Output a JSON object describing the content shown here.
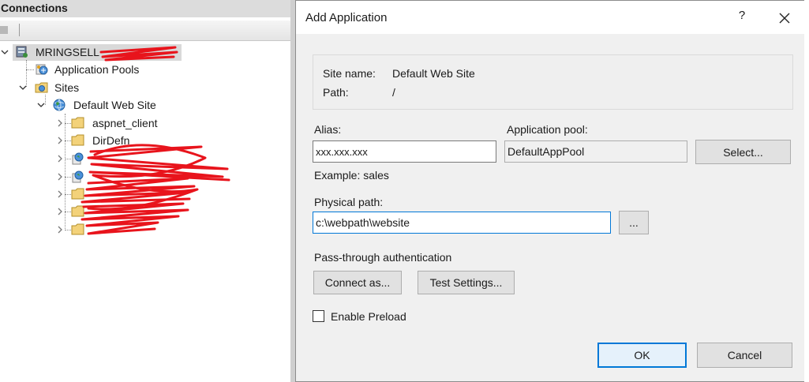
{
  "connections": {
    "title": "Connections",
    "tree": [
      {
        "label": "MRINGSELL"
      },
      {
        "label": "Application Pools"
      },
      {
        "label": "Sites"
      },
      {
        "label": "Default Web Site"
      },
      {
        "label": "aspnet_client"
      },
      {
        "label": "DirDefn"
      },
      {
        "label": ""
      },
      {
        "label": ""
      },
      {
        "label": ""
      },
      {
        "label": ""
      },
      {
        "label": ""
      }
    ]
  },
  "dialog": {
    "title": "Add Application",
    "help": "?",
    "site_name_label": "Site name:",
    "site_name_value": "Default Web Site",
    "path_label": "Path:",
    "path_value": "/",
    "alias_label": "Alias:",
    "alias_value": "xxx.xxx.xxx",
    "alias_example": "Example: sales",
    "app_pool_label": "Application pool:",
    "app_pool_value": "DefaultAppPool",
    "select_button": "Select...",
    "physical_path_label": "Physical path:",
    "physical_path_value": "c:\\webpath\\website",
    "browse_button": "...",
    "passthrough_label": "Pass-through authentication",
    "connect_as_button": "Connect as...",
    "test_settings_button": "Test Settings...",
    "enable_preload_label": "Enable Preload",
    "enable_preload_checked": false,
    "ok_button": "OK",
    "cancel_button": "Cancel"
  },
  "colors": {
    "accent": "#0078d7",
    "folder": "#f3d27a",
    "redaction": "#e8141c"
  }
}
